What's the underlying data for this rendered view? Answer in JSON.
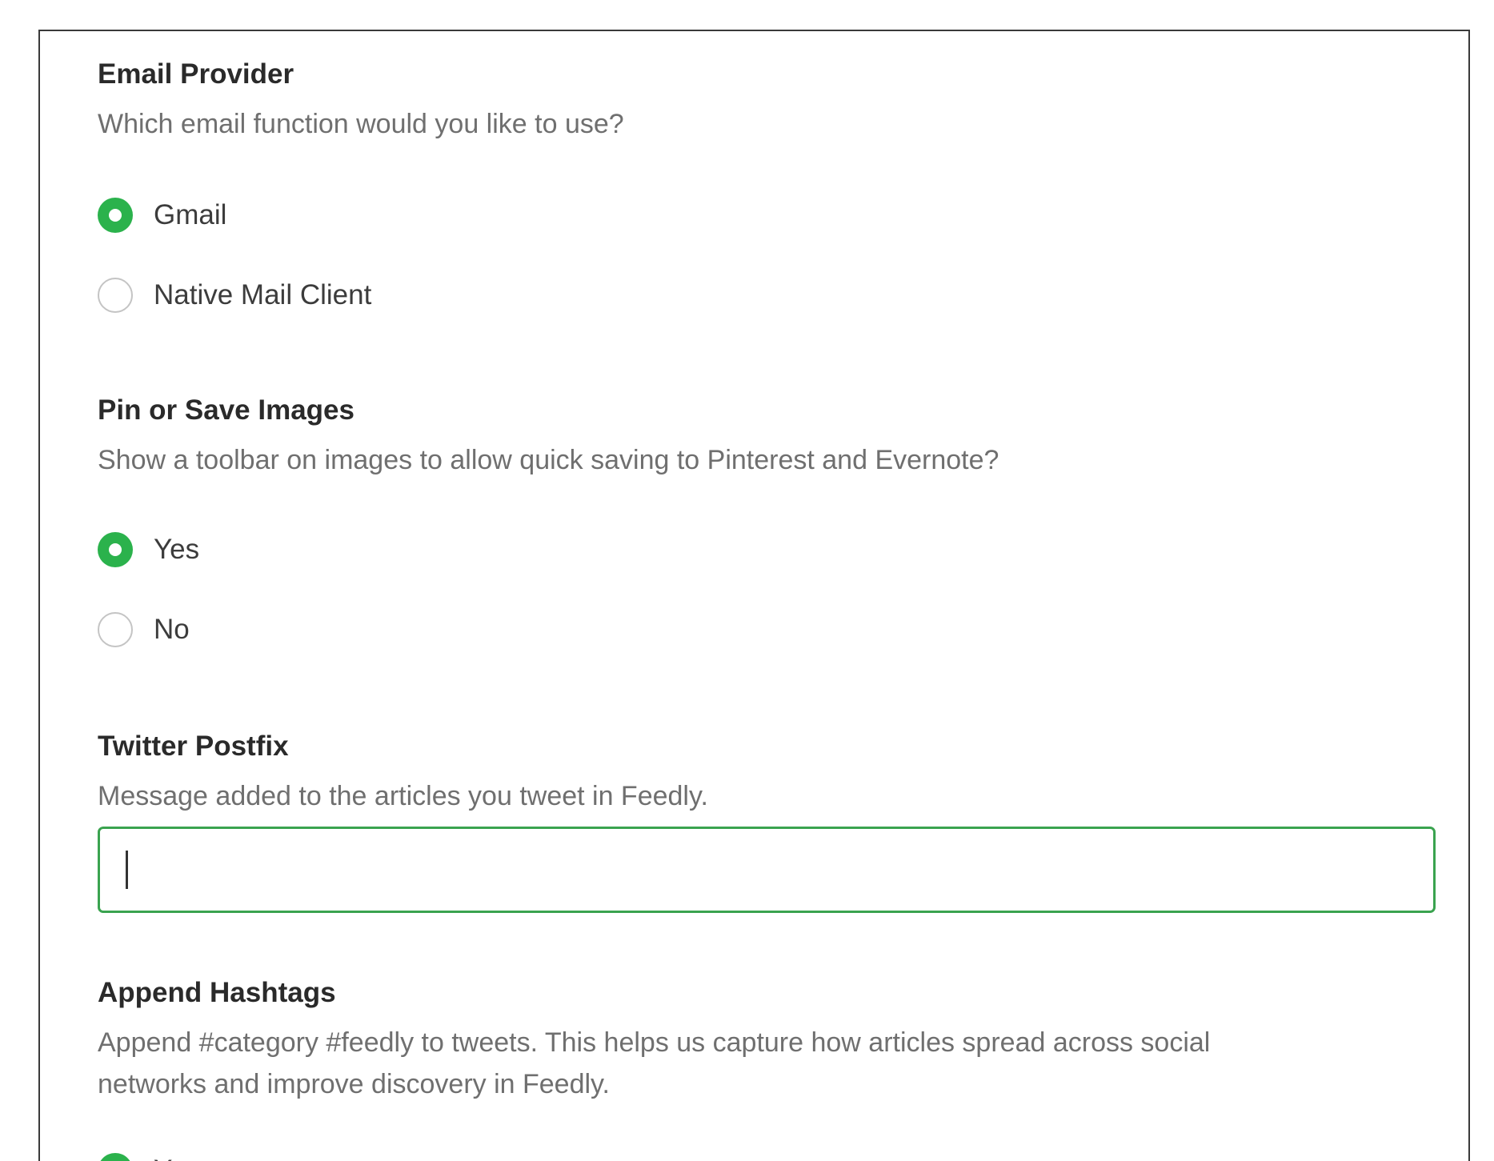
{
  "sections": {
    "email_provider": {
      "title": "Email Provider",
      "description": "Which email function would you like to use?",
      "options": [
        {
          "label": "Gmail",
          "selected": true
        },
        {
          "label": "Native Mail Client",
          "selected": false
        }
      ]
    },
    "pin_save_images": {
      "title": "Pin or Save Images",
      "description": "Show a toolbar on images to allow quick saving to Pinterest and Evernote?",
      "options": [
        {
          "label": "Yes",
          "selected": true
        },
        {
          "label": "No",
          "selected": false
        }
      ]
    },
    "twitter_postfix": {
      "title": "Twitter Postfix",
      "description": "Message added to the articles you tweet in Feedly.",
      "input_value": "",
      "input_placeholder": ""
    },
    "append_hashtags": {
      "title": "Append Hashtags",
      "description_line1": "Append #category #feedly to tweets. This helps us capture how articles spread across social",
      "description_line2": "networks and improve discovery in Feedly.",
      "options": [
        {
          "label": "Yes",
          "selected": true
        }
      ]
    }
  },
  "colors": {
    "accent_green": "#2bb24c",
    "input_border_green": "#3aa34f",
    "panel_border": "#3a3a3a"
  }
}
